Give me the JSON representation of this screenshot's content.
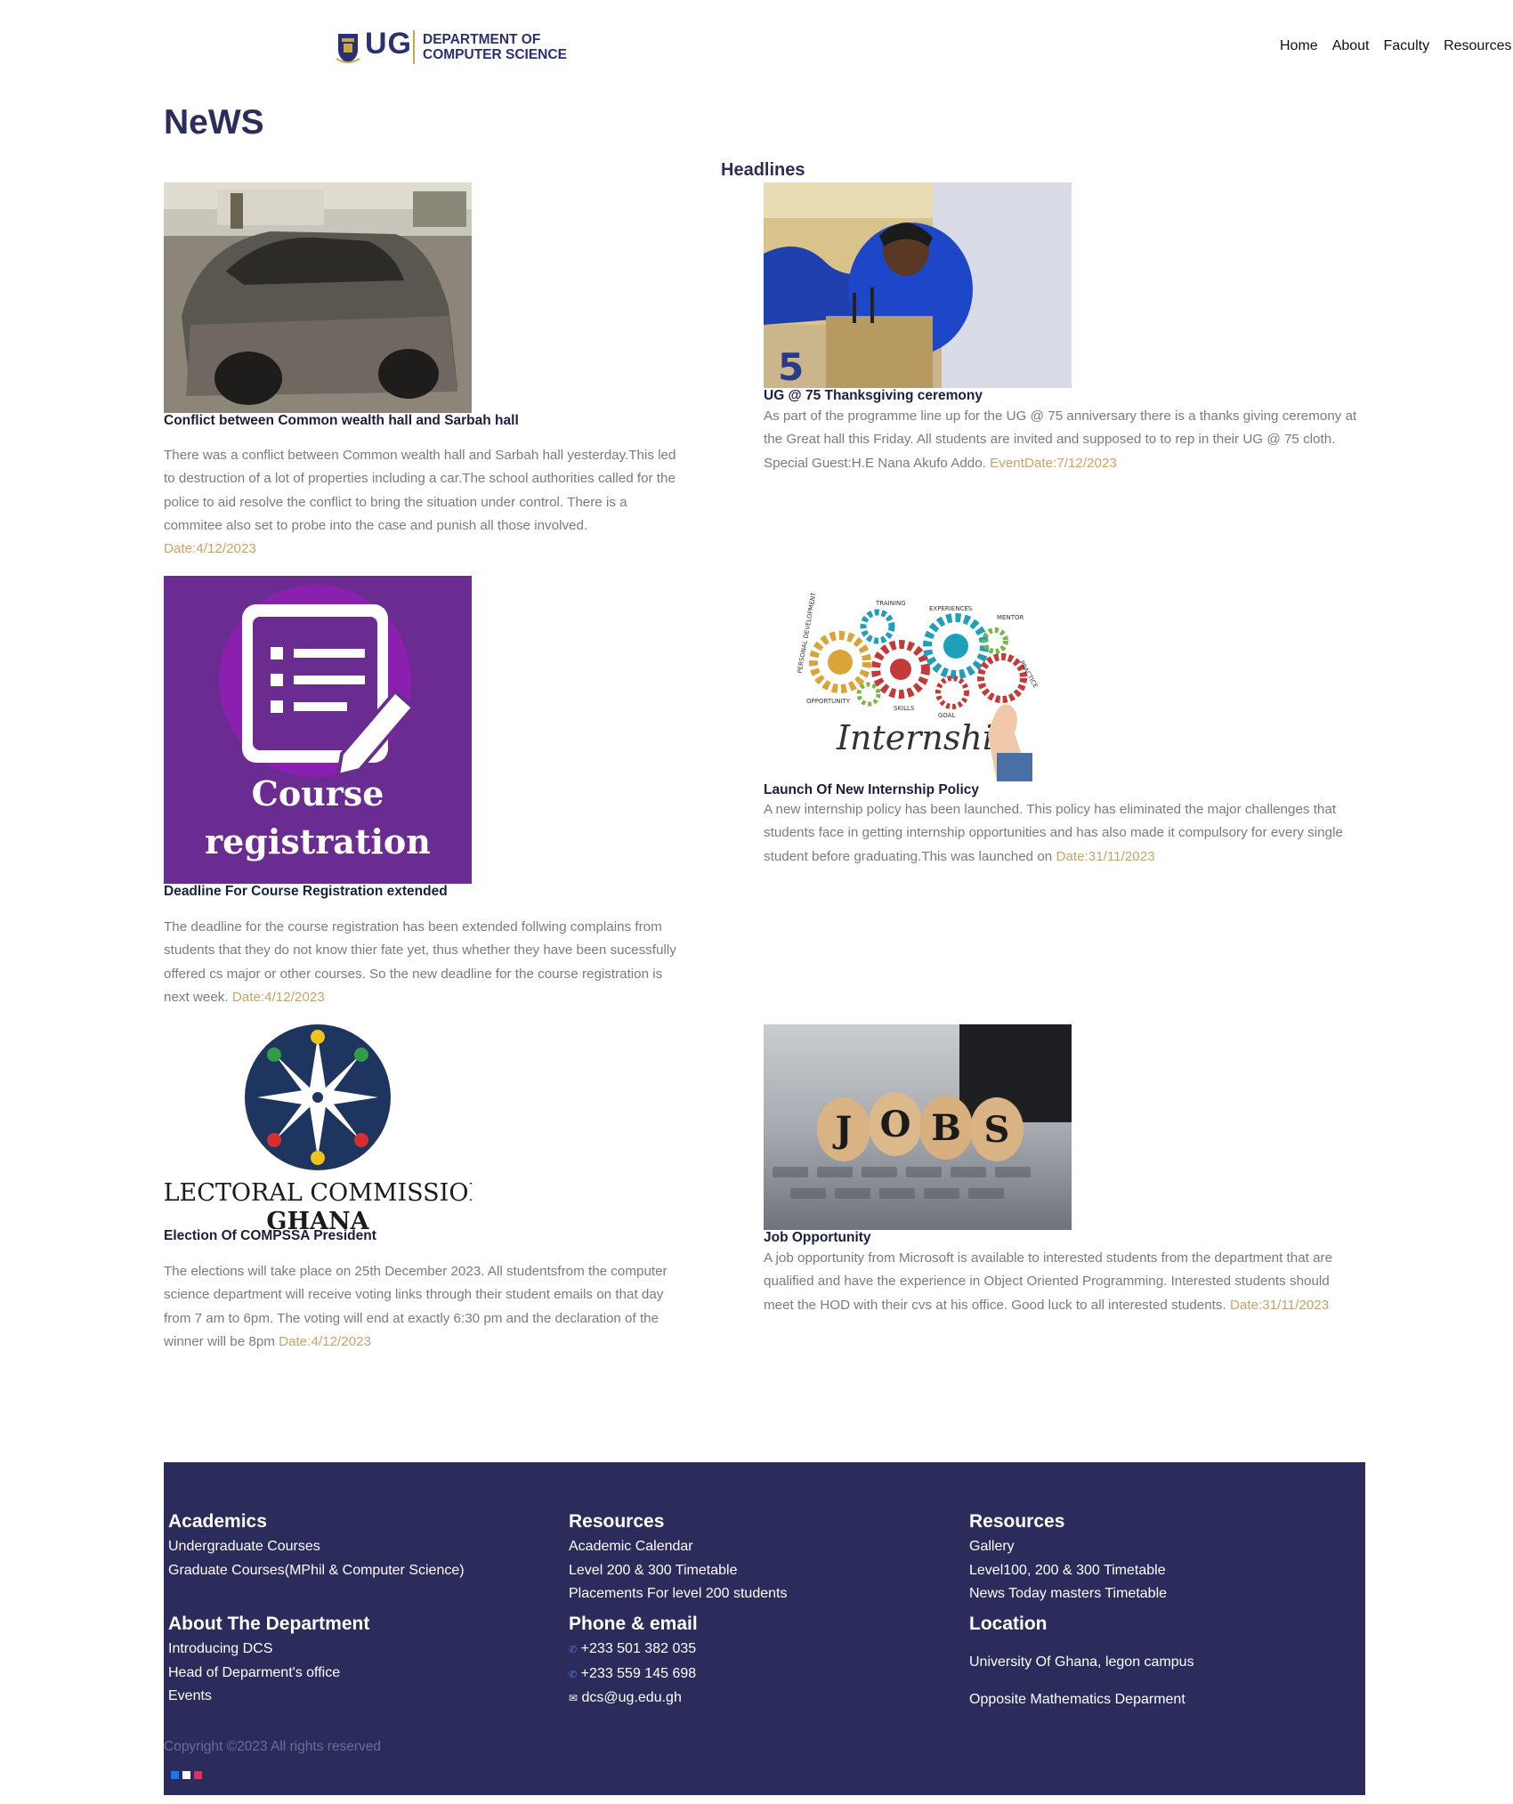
{
  "header": {
    "logo_ug": "UG",
    "logo_dept_line1": "DEPARTMENT OF",
    "logo_dept_line2": "COMPUTER SCIENCE",
    "nav": [
      "Home",
      "About",
      "Faculty",
      "Resources"
    ]
  },
  "page_title": "NeWS",
  "headlines_label": "Headlines",
  "articles": [
    {
      "title": "Conflict between Common wealth hall and Sarbah hall",
      "body": "There was a conflict between Common wealth hall and Sarbah hall yesterday.This led to destruction of a lot of properties including a car.The school authorities called for the police to aid resolve the conflict to bring the situation under control. There is a commitee also set to probe into the case and punish all those involved.",
      "date": "Date:4/12/2023",
      "image": "burnt-car-photo"
    },
    {
      "title": "UG @ 75 Thanksgiving ceremony",
      "body": "As part of the programme line up for the UG @ 75 anniversary there is a thanks giving ceremony at the Great hall this Friday. All students are invited and supposed to to rep in their UG @ 75 cloth. Special Guest:H.E Nana Akufo Addo.",
      "date": "EventDate:7/12/2023",
      "image": "speaker-at-podium-photo",
      "image_text": "5"
    },
    {
      "title": "Deadline For Course Registration extended",
      "body": "The deadline for the course registration has been extended follwing complains from students that they do not know thier fate yet, thus whether they have been sucessfully offered cs major or other courses. So the new deadline for the course registration is next week.",
      "date": "Date:4/12/2023",
      "image": "course-registration-graphic",
      "image_text_line1": "Course",
      "image_text_line2": "registration"
    },
    {
      "title": "Launch Of New Internship Policy",
      "body": "A new internship policy has been launched. This policy has eliminated the major challenges that students face in getting internship opportunities and has also made it compulsory for every single student before graduating.This was launched on",
      "date": "Date:31/11/2023",
      "image": "internship-gears-graphic",
      "image_text": "Internship",
      "image_gear_labels": [
        "TRAINING",
        "PERSONAL DEVELOPMENT",
        "EXPERIENCES",
        "MENTOR",
        "PRACTICE",
        "OPPORTUNITY",
        "SKILLS",
        "GOAL"
      ]
    },
    {
      "title": "Election Of COMPSSA President",
      "body": "The elections will take place on 25th December 2023. All studentsfrom the computer science department will receive voting links through their student emails on that day from 7 am to 6pm. The voting will end at exactly 6:30 pm and the declaration of the winner will be 8pm",
      "date": "Date:4/12/2023",
      "image": "electoral-commission-logo",
      "image_text_line1": "ELECTORAL COMMISSION",
      "image_text_line2": "GHANA"
    },
    {
      "title": "Job Opportunity",
      "body": "A job opportunity from Microsoft is available to interested students from the department that are qualified and have the experience in Object Oriented Programming. Interested students should meet the HOD with their cvs at his office. Good luck to all interested students.",
      "date": "Date:31/11/2023",
      "image": "jobs-blocks-photo",
      "image_letters": [
        "J",
        "O",
        "B",
        "S"
      ]
    }
  ],
  "footer": {
    "academics": {
      "heading": "Academics",
      "links": [
        "Undergraduate Courses",
        "Graduate Courses(MPhil & Computer Science)"
      ]
    },
    "resources1": {
      "heading": "Resources",
      "links": [
        "Academic Calendar",
        "Level 200 & 300 Timetable",
        "Placements For level 200 students"
      ]
    },
    "resources2": {
      "heading": "Resources",
      "links": [
        "Gallery",
        "Level100, 200 & 300 Timetable",
        "News Today masters Timetable"
      ]
    },
    "about": {
      "heading": "About The Department",
      "links": [
        "Introducing DCS",
        "Head of Deparment's office",
        "Events"
      ]
    },
    "contact": {
      "heading": "Phone & email",
      "phone1": "+233 501 382 035",
      "phone2": "+233 559 145 698",
      "email": "dcs@ug.edu.gh"
    },
    "location": {
      "heading": "Location",
      "line1": "University Of Ghana, legon campus",
      "line2": "Opposite Mathematics Deparment"
    },
    "copyright": "Copyright ©2023 All rights reserved",
    "social_icons": [
      "facebook-icon",
      "x-icon",
      "instagram-icon"
    ]
  },
  "colors": {
    "navy": "#2b2b5c",
    "gold_date": "#c9a268",
    "purple": "#6a2c91"
  }
}
